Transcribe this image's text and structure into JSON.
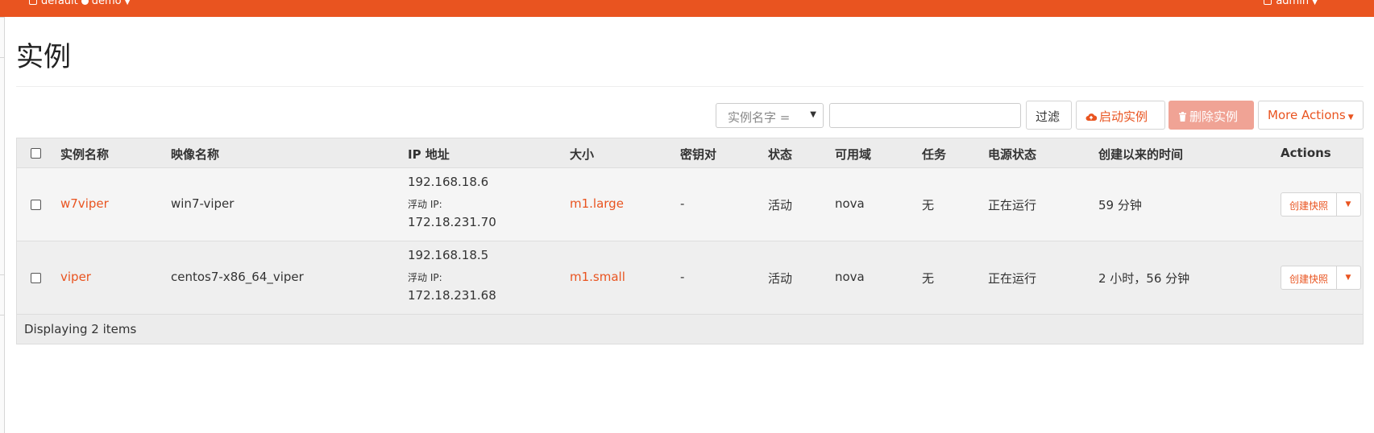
{
  "topbar": {
    "project_domain": "default",
    "project_name": "demo",
    "user": "admin"
  },
  "page": {
    "title": "实例"
  },
  "toolbar": {
    "filter_field": "实例名字 =",
    "filter_value": "",
    "filter_button": "过滤",
    "launch_button": "启动实例",
    "delete_button": "删除实例",
    "more_actions": "More Actions"
  },
  "table": {
    "headers": [
      "实例名称",
      "映像名称",
      "IP 地址",
      "大小",
      "密钥对",
      "状态",
      "可用域",
      "任务",
      "电源状态",
      "创建以来的时间",
      "Actions"
    ],
    "rows": [
      {
        "name": "w7viper",
        "image": "win7-viper",
        "ip": "192.168.18.6",
        "floating_label": "浮动 IP:",
        "floating_ip": "172.18.231.70",
        "size": "m1.large",
        "keypair": "-",
        "status": "活动",
        "zone": "nova",
        "task": "无",
        "power": "正在运行",
        "age": "59 分钟",
        "action": "创建快照"
      },
      {
        "name": "viper",
        "image": "centos7-x86_64_viper",
        "ip": "192.168.18.5",
        "floating_label": "浮动 IP:",
        "floating_ip": "172.18.231.68",
        "size": "m1.small",
        "keypair": "-",
        "status": "活动",
        "zone": "nova",
        "task": "无",
        "power": "正在运行",
        "age": "2 小时，56 分钟",
        "action": "创建快照"
      }
    ],
    "footer": "Displaying 2 items"
  },
  "colors": {
    "accent": "#e95420",
    "delete_disabled": "#f0a395"
  },
  "icons": [
    "project-icon",
    "globe-dot-icon",
    "user-icon",
    "cloud-upload-icon",
    "trash-icon",
    "caret-down-icon"
  ]
}
